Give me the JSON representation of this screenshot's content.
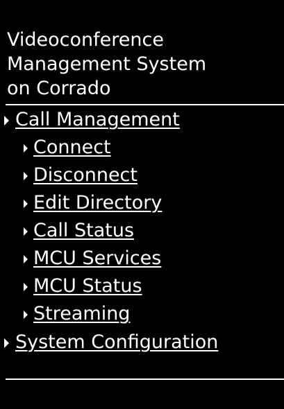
{
  "header": {
    "title_line1": "Videoconference",
    "title_line2": "Management System",
    "title_line3": "on Corrado"
  },
  "nav": {
    "call_management": "Call Management",
    "items": {
      "connect": "Connect",
      "disconnect": "Disconnect",
      "edit_directory": "Edit Directory",
      "call_status": "Call Status",
      "mcu_services": "MCU Services",
      "mcu_status": "MCU Status",
      "streaming": "Streaming"
    },
    "system_configuration": "System Configuration"
  },
  "colors": {
    "background": "#000000",
    "text": "#ffffff"
  },
  "icons": {
    "bullet": "triangle-right-icon"
  }
}
